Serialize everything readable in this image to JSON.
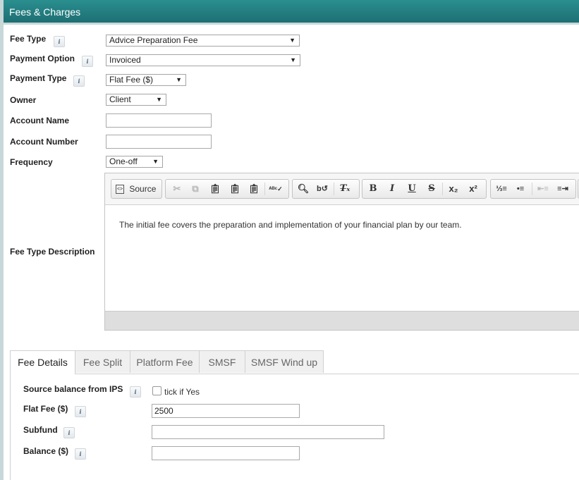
{
  "header": {
    "title": "Fees & Charges"
  },
  "form": {
    "fee_type": {
      "label": "Fee Type",
      "value": "Advice Preparation Fee"
    },
    "payment_option": {
      "label": "Payment Option",
      "value": "Invoiced"
    },
    "payment_type": {
      "label": "Payment Type",
      "value": "Flat Fee ($)"
    },
    "owner": {
      "label": "Owner",
      "value": "Client"
    },
    "account_name": {
      "label": "Account Name",
      "value": ""
    },
    "account_number": {
      "label": "Account Number",
      "value": ""
    },
    "frequency": {
      "label": "Frequency",
      "value": "One-off"
    },
    "fee_type_description": {
      "label": "Fee Type Description"
    }
  },
  "editor": {
    "source_label": "Source",
    "content": "The initial fee covers the preparation and implementation of your financial plan by our team."
  },
  "tabs": [
    "Fee Details",
    "Fee Split",
    "Platform Fee",
    "SMSF",
    "SMSF Wind up"
  ],
  "fee_details": {
    "source_balance": {
      "label": "Source balance from IPS",
      "checkbox_label": "tick if Yes",
      "checked": false
    },
    "flat_fee": {
      "label": "Flat Fee ($)",
      "value": "2500"
    },
    "subfund": {
      "label": "Subfund",
      "value": ""
    },
    "balance": {
      "label": "Balance ($)",
      "value": ""
    }
  },
  "icons": {
    "info": "i"
  }
}
